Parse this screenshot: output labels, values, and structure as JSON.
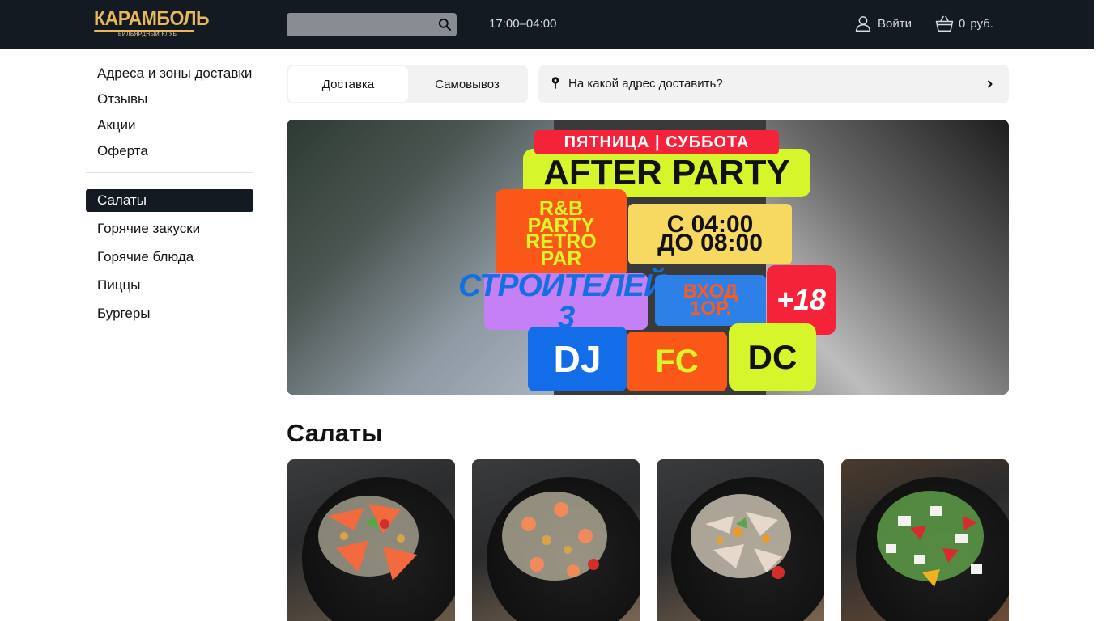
{
  "header": {
    "logo": {
      "main": "КАРАМБОЛЬ",
      "sub": "БИЛЬЯРДНЫЙ КЛУБ"
    },
    "search": {
      "value": "",
      "placeholder": ""
    },
    "hours": "17:00–04:00",
    "login_label": "Войти",
    "cart": {
      "count": "0",
      "currency": "руб."
    },
    "colors": {
      "bar": "#131a22",
      "accent": "#e8b85a"
    }
  },
  "sidebar": {
    "info_links": [
      "Адреса и зоны доставки",
      "Отзывы",
      "Акции",
      "Оферта"
    ],
    "categories": [
      {
        "label": "Салаты",
        "active": true
      },
      {
        "label": "Горячие закуски",
        "active": false
      },
      {
        "label": "Горячие блюда",
        "active": false
      },
      {
        "label": "Пиццы",
        "active": false
      },
      {
        "label": "Бургеры",
        "active": false
      }
    ]
  },
  "delivery": {
    "options": [
      "Доставка",
      "Самовывоз"
    ],
    "selected": "Доставка",
    "address_prompt": "На какой адрес доставить?"
  },
  "banner": {
    "top_line": "ПЯТНИЦА | СУББОТА",
    "title": "AFTER PARTY",
    "party": "R&B\nPARTY\nRETRO\nPAR",
    "time": "С 04:00\nДО 08:00",
    "street": "СТРОИТЕЛЕЙ. 3",
    "entry": "ВХОД\n1ОР.",
    "age": "+18",
    "tags": [
      "DJ",
      "FC",
      "DC"
    ]
  },
  "section": {
    "title": "Салаты",
    "products": [
      {
        "image": "salad-salmon-photo"
      },
      {
        "image": "salad-shrimp-photo"
      },
      {
        "image": "salad-chicken-caesar-photo"
      },
      {
        "image": "salad-greek-photo"
      }
    ]
  }
}
